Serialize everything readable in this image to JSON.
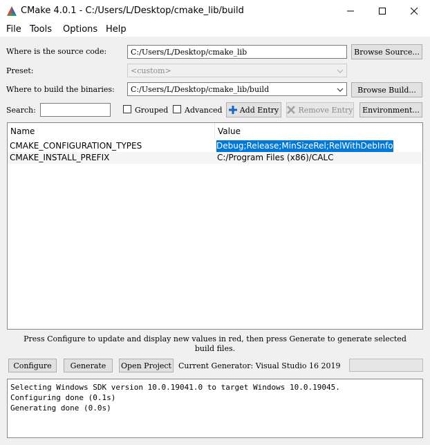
{
  "window": {
    "title": "CMake 4.0.1 - C:/Users/L/Desktop/cmake_lib/build"
  },
  "menu": {
    "items": [
      "File",
      "Tools",
      "Options",
      "Help"
    ]
  },
  "source": {
    "label": "Where is the source code:",
    "value": "C:/Users/L/Desktop/cmake_lib",
    "browse_label": "Browse Source..."
  },
  "preset": {
    "label": "Preset:",
    "value": "<custom>"
  },
  "build": {
    "label": "Where to build the binaries:",
    "value": "C:/Users/L/Desktop/cmake_lib/build",
    "browse_label": "Browse Build..."
  },
  "search": {
    "label": "Search:",
    "value": ""
  },
  "options": {
    "grouped_label": "Grouped",
    "grouped_checked": false,
    "advanced_label": "Advanced",
    "advanced_checked": false
  },
  "toolbar": {
    "add_entry_label": "Add Entry",
    "remove_entry_label": "Remove Entry",
    "environment_label": "Environment..."
  },
  "table": {
    "columns": [
      "Name",
      "Value"
    ],
    "rows": [
      {
        "name": "CMAKE_CONFIGURATION_TYPES",
        "value": "Debug;Release;MinSizeRel;RelWithDebInfo"
      },
      {
        "name": "CMAKE_INSTALL_PREFIX",
        "value": "C:/Program Files (x86)/CALC"
      }
    ]
  },
  "hint": {
    "line1": "Press Configure to update and display new values in red, then press Generate to generate selected",
    "line2": "build files."
  },
  "actions": {
    "configure_label": "Configure",
    "generate_label": "Generate",
    "open_project_label": "Open Project",
    "generator_text": "Current Generator: Visual Studio 16 2019"
  },
  "output": {
    "lines": [
      "Selecting Windows SDK version 10.0.19041.0 to target Windows 10.0.19045.",
      "Configuring done (0.1s)",
      "Generating done (0.0s)"
    ]
  },
  "colors": {
    "selection": "#0078d7",
    "add_icon": "#1e5fc8"
  },
  "icons": {
    "app": "cmake-triangle-icon",
    "add": "plus-icon",
    "remove": "x-icon"
  }
}
